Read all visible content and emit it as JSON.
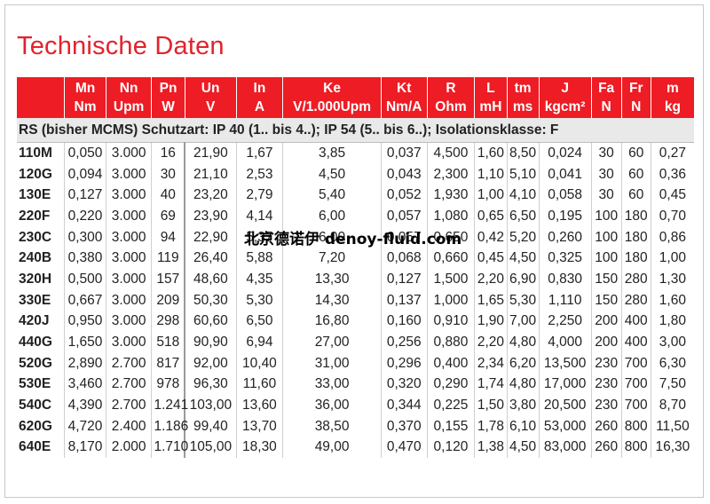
{
  "title": "Technische Daten",
  "columns": [
    {
      "name": "",
      "unit": ""
    },
    {
      "name": "Mn",
      "unit": "Nm"
    },
    {
      "name": "Nn",
      "unit": "Upm"
    },
    {
      "name": "Pn",
      "unit": "W"
    },
    {
      "name": "Un",
      "unit": "V"
    },
    {
      "name": "In",
      "unit": "A"
    },
    {
      "name": "Ke",
      "unit": "V/1.000Upm"
    },
    {
      "name": "Kt",
      "unit": "Nm/A"
    },
    {
      "name": "R",
      "unit": "Ohm"
    },
    {
      "name": "L",
      "unit": "mH"
    },
    {
      "name": "tm",
      "unit": "ms"
    },
    {
      "name": "J",
      "unit": "kgcm²"
    },
    {
      "name": "Fa",
      "unit": "N"
    },
    {
      "name": "Fr",
      "unit": "N"
    },
    {
      "name": "m",
      "unit": "kg"
    }
  ],
  "group": {
    "label": "RS (bisher MCMS)",
    "description": " Schutzart: IP 40 (1.. bis 4..); IP 54 (5.. bis 6..); Isolationsklasse: F"
  },
  "rows": [
    [
      "110M",
      "0,050",
      "3.000",
      "16",
      "21,90",
      "1,67",
      "3,85",
      "0,037",
      "4,500",
      "1,60",
      "8,50",
      "0,024",
      "30",
      "60",
      "0,27"
    ],
    [
      "120G",
      "0,094",
      "3.000",
      "30",
      "21,10",
      "2,53",
      "4,50",
      "0,043",
      "2,300",
      "1,10",
      "5,10",
      "0,041",
      "30",
      "60",
      "0,36"
    ],
    [
      "130E",
      "0,127",
      "3.000",
      "40",
      "23,20",
      "2,79",
      "5,40",
      "0,052",
      "1,930",
      "1,00",
      "4,10",
      "0,058",
      "30",
      "60",
      "0,45"
    ],
    [
      "220F",
      "0,220",
      "3.000",
      "69",
      "23,90",
      "4,14",
      "6,00",
      "0,057",
      "1,080",
      "0,65",
      "6,50",
      "0,195",
      "100",
      "180",
      "0,70"
    ],
    [
      "230C",
      "0,300",
      "3.000",
      "94",
      "22,90",
      "5,37",
      "6,00",
      "0,057",
      "0,650",
      "0,42",
      "5,20",
      "0,260",
      "100",
      "180",
      "0,86"
    ],
    [
      "240B",
      "0,380",
      "3.000",
      "119",
      "26,40",
      "5,88",
      "7,20",
      "0,068",
      "0,660",
      "0,45",
      "4,50",
      "0,325",
      "100",
      "180",
      "1,00"
    ],
    [
      "320H",
      "0,500",
      "3.000",
      "157",
      "48,60",
      "4,35",
      "13,30",
      "0,127",
      "1,500",
      "2,20",
      "6,90",
      "0,830",
      "150",
      "280",
      "1,30"
    ],
    [
      "330E",
      "0,667",
      "3.000",
      "209",
      "50,30",
      "5,30",
      "14,30",
      "0,137",
      "1,000",
      "1,65",
      "5,30",
      "1,110",
      "150",
      "280",
      "1,60"
    ],
    [
      "420J",
      "0,950",
      "3.000",
      "298",
      "60,60",
      "6,50",
      "16,80",
      "0,160",
      "0,910",
      "1,90",
      "7,00",
      "2,250",
      "200",
      "400",
      "1,80"
    ],
    [
      "440G",
      "1,650",
      "3.000",
      "518",
      "90,90",
      "6,94",
      "27,00",
      "0,256",
      "0,880",
      "2,20",
      "4,80",
      "4,000",
      "200",
      "400",
      "3,00"
    ],
    [
      "520G",
      "2,890",
      "2.700",
      "817",
      "92,00",
      "10,40",
      "31,00",
      "0,296",
      "0,400",
      "2,34",
      "6,20",
      "13,500",
      "230",
      "700",
      "6,30"
    ],
    [
      "530E",
      "3,460",
      "2.700",
      "978",
      "96,30",
      "11,60",
      "33,00",
      "0,320",
      "0,290",
      "1,74",
      "4,80",
      "17,000",
      "230",
      "700",
      "7,50"
    ],
    [
      "540C",
      "4,390",
      "2.700",
      "1.241",
      "103,00",
      "13,60",
      "36,00",
      "0,344",
      "0,225",
      "1,50",
      "3,80",
      "20,500",
      "230",
      "700",
      "8,70"
    ],
    [
      "620G",
      "4,720",
      "2.400",
      "1.186",
      "99,40",
      "13,70",
      "38,50",
      "0,370",
      "0,155",
      "1,78",
      "6,10",
      "53,000",
      "260",
      "800",
      "11,50"
    ],
    [
      "640E",
      "8,170",
      "2.000",
      "1.710",
      "105,00",
      "18,30",
      "49,00",
      "0,470",
      "0,120",
      "1,38",
      "4,50",
      "83,000",
      "260",
      "800",
      "16,30"
    ]
  ],
  "watermark": "北京德诺伊 denoy-fluid.com",
  "colors": {
    "accent": "#ee1c24",
    "title": "#e0232b",
    "group_bg": "#e9e9e9"
  }
}
